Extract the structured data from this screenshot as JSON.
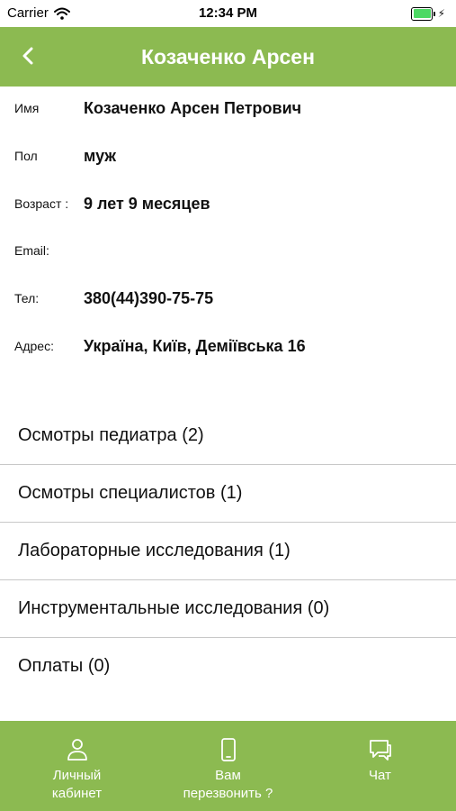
{
  "status_bar": {
    "carrier": "Carrier",
    "time": "12:34 PM",
    "battery_color": "#4cd964",
    "icons": [
      "wifi-icon",
      "battery-icon",
      "charging-bolt-icon"
    ]
  },
  "header": {
    "title": "Козаченко Арсен",
    "back_icon": "chevron-left-icon",
    "background": "#8cba51"
  },
  "patient": {
    "fields": [
      {
        "label": "Имя",
        "value": "Козаченко Арсен Петрович"
      },
      {
        "label": "Пол",
        "value": "муж"
      },
      {
        "label": "Возраст :",
        "value": "9 лет 9 месяцев"
      },
      {
        "label": "Email:",
        "value": ""
      },
      {
        "label": "Тел:",
        "value": "380(44)390-75-75"
      },
      {
        "label": "Адрес:",
        "value": "Україна, Київ, Деміївська 16"
      }
    ]
  },
  "menu": {
    "items": [
      {
        "label": "Осмотры педиатра (2)"
      },
      {
        "label": "Осмотры специалистов (1)"
      },
      {
        "label": "Лабораторные исследования (1)"
      },
      {
        "label": "Инструментальные исследования (0)"
      },
      {
        "label": "Оплаты (0)"
      }
    ]
  },
  "tab_bar": {
    "background": "#8cba51",
    "tabs": [
      {
        "label": "Личный\nкабинет",
        "icon": "person-icon"
      },
      {
        "label": "Вам\nперезвонить ?",
        "icon": "phone-icon"
      },
      {
        "label": "Чат",
        "icon": "chat-icon"
      }
    ]
  }
}
